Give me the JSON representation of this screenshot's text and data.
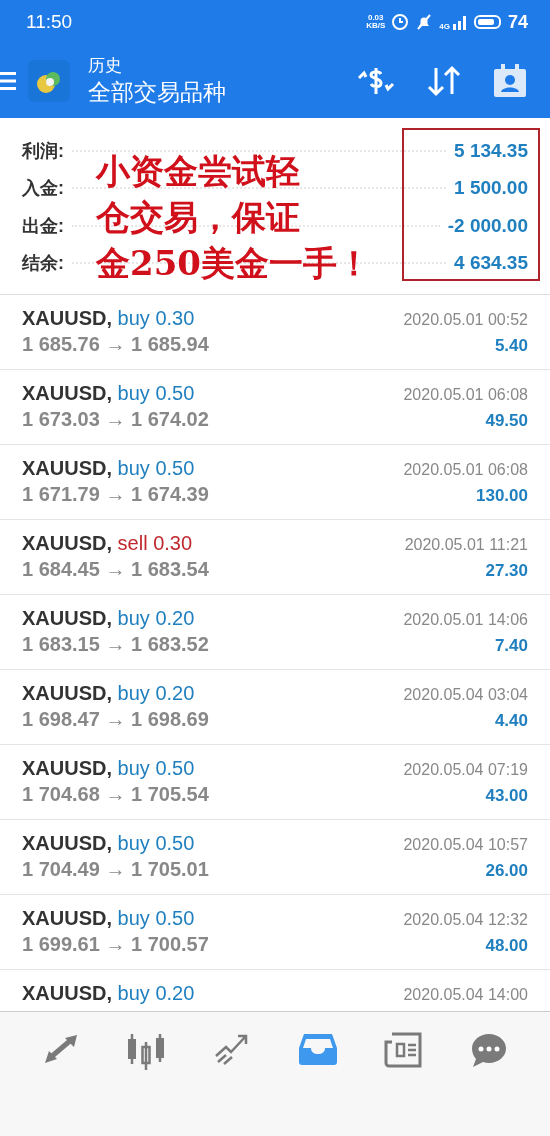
{
  "status_bar": {
    "time": "11:50",
    "net_speed": "0.03",
    "net_unit": "KB/S",
    "network": "4G",
    "battery": "74"
  },
  "header": {
    "title": "历史",
    "subtitle": "全部交易品种"
  },
  "summary": [
    {
      "label": "利润:",
      "value": "5 134.35"
    },
    {
      "label": "入金:",
      "value": "1 500.00"
    },
    {
      "label": "出金:",
      "value": "-2 000.00"
    },
    {
      "label": "结余:",
      "value": "4 634.35"
    }
  ],
  "annotation": {
    "lines": [
      "小资金尝试轻",
      "仓交易，保证",
      "金250美金一手！"
    ]
  },
  "trades": [
    {
      "symbol": "XAUUSD,",
      "kind": "buy",
      "side": "buy",
      "volume": "0.30",
      "prices": "1 685.76 → 1 685.94",
      "time": "2020.05.01 00:52",
      "profit": "5.40"
    },
    {
      "symbol": "XAUUSD,",
      "kind": "buy",
      "side": "buy",
      "volume": "0.50",
      "prices": "1 673.03 → 1 674.02",
      "time": "2020.05.01 06:08",
      "profit": "49.50"
    },
    {
      "symbol": "XAUUSD,",
      "kind": "buy",
      "side": "buy",
      "volume": "0.50",
      "prices": "1 671.79 → 1 674.39",
      "time": "2020.05.01 06:08",
      "profit": "130.00"
    },
    {
      "symbol": "XAUUSD,",
      "kind": "sell",
      "side": "sell",
      "volume": "0.30",
      "prices": "1 684.45 → 1 683.54",
      "time": "2020.05.01 11:21",
      "profit": "27.30"
    },
    {
      "symbol": "XAUUSD,",
      "kind": "buy",
      "side": "buy",
      "volume": "0.20",
      "prices": "1 683.15 → 1 683.52",
      "time": "2020.05.01 14:06",
      "profit": "7.40"
    },
    {
      "symbol": "XAUUSD,",
      "kind": "buy",
      "side": "buy",
      "volume": "0.20",
      "prices": "1 698.47 → 1 698.69",
      "time": "2020.05.04 03:04",
      "profit": "4.40"
    },
    {
      "symbol": "XAUUSD,",
      "kind": "buy",
      "side": "buy",
      "volume": "0.50",
      "prices": "1 704.68 → 1 705.54",
      "time": "2020.05.04 07:19",
      "profit": "43.00"
    },
    {
      "symbol": "XAUUSD,",
      "kind": "buy",
      "side": "buy",
      "volume": "0.50",
      "prices": "1 704.49 → 1 705.01",
      "time": "2020.05.04 10:57",
      "profit": "26.00"
    },
    {
      "symbol": "XAUUSD,",
      "kind": "buy",
      "side": "buy",
      "volume": "0.50",
      "prices": "1 699.61 → 1 700.57",
      "time": "2020.05.04 12:32",
      "profit": "48.00"
    },
    {
      "symbol": "XAUUSD,",
      "kind": "buy",
      "side": "buy",
      "volume": "0.20",
      "time": "2020.05.04 14:00"
    }
  ],
  "nav": [
    {
      "kind": "quotes",
      "selected": false
    },
    {
      "kind": "chart",
      "selected": false
    },
    {
      "kind": "trade",
      "selected": false
    },
    {
      "kind": "history",
      "selected": true
    },
    {
      "kind": "news",
      "selected": false
    },
    {
      "kind": "chat",
      "selected": false
    }
  ]
}
